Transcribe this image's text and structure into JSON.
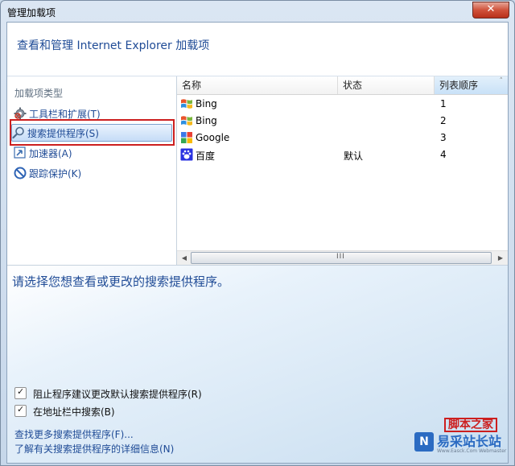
{
  "window": {
    "title": "管理加载项",
    "close_label": "✕"
  },
  "header": {
    "text": "查看和管理 Internet Explorer 加载项"
  },
  "sidebar": {
    "title": "加载项类型",
    "items": [
      {
        "label": "工具栏和扩展(T)",
        "icon": "gear-icon"
      },
      {
        "label": "搜索提供程序(S)",
        "icon": "search-icon",
        "selected": true
      },
      {
        "label": "加速器(A)",
        "icon": "accelerator-icon"
      },
      {
        "label": "跟踪保护(K)",
        "icon": "block-icon"
      }
    ]
  },
  "list": {
    "columns": [
      "名称",
      "状态",
      "列表顺序"
    ],
    "sort_arrow": "˄",
    "rows": [
      {
        "name": "Bing",
        "status": "",
        "order": "1",
        "icon": "windows-flag-icon"
      },
      {
        "name": "Bing",
        "status": "",
        "order": "2",
        "icon": "windows-flag-icon"
      },
      {
        "name": "Google",
        "status": "",
        "order": "3",
        "icon": "google-icon"
      },
      {
        "name": "百度",
        "status": "默认",
        "order": "4",
        "icon": "baidu-paw-icon"
      }
    ],
    "scroll_left": "◀",
    "scroll_right": "▶",
    "scroll_grip": "III"
  },
  "details": {
    "prompt": "请选择您想查看或更改的搜索提供程序。",
    "checkboxes": [
      {
        "label": "阻止程序建议更改默认搜索提供程序(R)",
        "checked": true
      },
      {
        "label": "在地址栏中搜索(B)",
        "checked": true
      }
    ],
    "check_mark": "✓",
    "links": [
      "查找更多搜索提供程序(F)...",
      "了解有关搜索提供程序的详细信息(N)"
    ]
  },
  "watermark": {
    "stamp": "脚本之家",
    "logo": "N",
    "text": "易采站长站",
    "sub": "Www.Easck.Com Webmaster"
  },
  "colors": {
    "accent": "#1f4b96",
    "highlight": "#cc1f1f",
    "selection": "#c5dcf7"
  }
}
